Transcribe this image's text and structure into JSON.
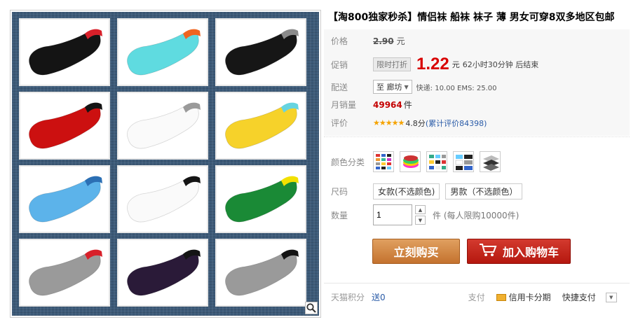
{
  "title": "【淘800独家秒杀】情侣袜 船袜 袜子 薄 男女可穿8双多地区包邮",
  "price": {
    "label": "价格",
    "original": "2.90",
    "unit": "元"
  },
  "promo": {
    "label": "促销",
    "tag": "限时打折",
    "price": "1.22",
    "unit": "元",
    "countdown": "62小时30分钟 后结束"
  },
  "shipping": {
    "label": "配送",
    "to": "至 廊坊",
    "info": "快递: 10.00 EMS: 25.00"
  },
  "sales": {
    "label": "月销量",
    "count": "49964",
    "unit": "件"
  },
  "rating": {
    "label": "评价",
    "stars": "★★★★★",
    "score": "4.8分",
    "reviews": "(累计评价84398)"
  },
  "color": {
    "label": "颜色分类",
    "swatches": [
      "multi-grid",
      "stack-colors",
      "pairs-grid",
      "stripe-set",
      "dark-set"
    ]
  },
  "size": {
    "label": "尺码",
    "options": [
      "女款(不选颜色)",
      "男款（不选颜色）"
    ]
  },
  "quantity": {
    "label": "数量",
    "value": "1",
    "note": "件 (每人限购10000件)"
  },
  "buttons": {
    "buy": "立刻购买",
    "cart": "加入购物车"
  },
  "bottom": {
    "points_label": "天猫积分",
    "points_value": "送0",
    "pay_label": "支付",
    "credit": "信用卡分期",
    "quick": "快捷支付"
  },
  "gallery": {
    "socks": [
      {
        "body": "#141414",
        "cuff": "#d8202a"
      },
      {
        "body": "#5fdbe0",
        "cuff": "#f06520"
      },
      {
        "body": "#161616",
        "cuff": "#8a8a8a"
      },
      {
        "body": "#cc1010",
        "cuff": "#141414"
      },
      {
        "body": "#fafafa",
        "cuff": "#9a9a9a"
      },
      {
        "body": "#f6d22a",
        "cuff": "#66d4e0"
      },
      {
        "body": "#5cb3ea",
        "cuff": "#2b6fb4"
      },
      {
        "body": "#fafafa",
        "cuff": "#141414"
      },
      {
        "body": "#1a8a36",
        "cuff": "#f2e000"
      },
      {
        "body": "#9a9a9a",
        "cuff": "#d8202a"
      },
      {
        "body": "#2a1a38",
        "cuff": "#141414"
      },
      {
        "body": "#9a9a9a",
        "cuff": "#141414"
      }
    ]
  }
}
